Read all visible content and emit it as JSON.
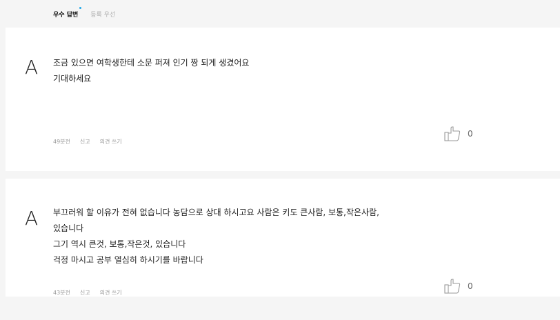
{
  "sort_tabs": [
    {
      "label": "우수 답변",
      "active": true
    },
    {
      "label": "등록 우선",
      "active": false
    }
  ],
  "colors": {
    "accent_dot": "#1fa8e8",
    "page_background": "#f5f5f5"
  },
  "answers": [
    {
      "avatar_letter": "A",
      "lines": [
        "조금 있으면 여학생한테 소문 퍼져 인기 짱 되게 생겼어요",
        "기대하세요"
      ],
      "time": "49분전",
      "report_label": "신고",
      "comment_label": "의견 쓰기",
      "like_count": "0",
      "like_icon": "thumbs-up-outline-icon"
    },
    {
      "avatar_letter": "A",
      "lines": [
        "부끄러워 할 이유가 전혀 없습니다 농담으로 상대 하시고요 사람은 키도 큰사람, 보통,작은사람,",
        "있습니다",
        "그기 역시 큰것, 보통,작은것, 있습니다",
        "걱정 마시고 공부 열심히 하시기를 바랍니다"
      ],
      "time": "43분전",
      "report_label": "신고",
      "comment_label": "의견 쓰기",
      "like_count": "0",
      "like_icon": "thumbs-up-outline-icon"
    }
  ]
}
